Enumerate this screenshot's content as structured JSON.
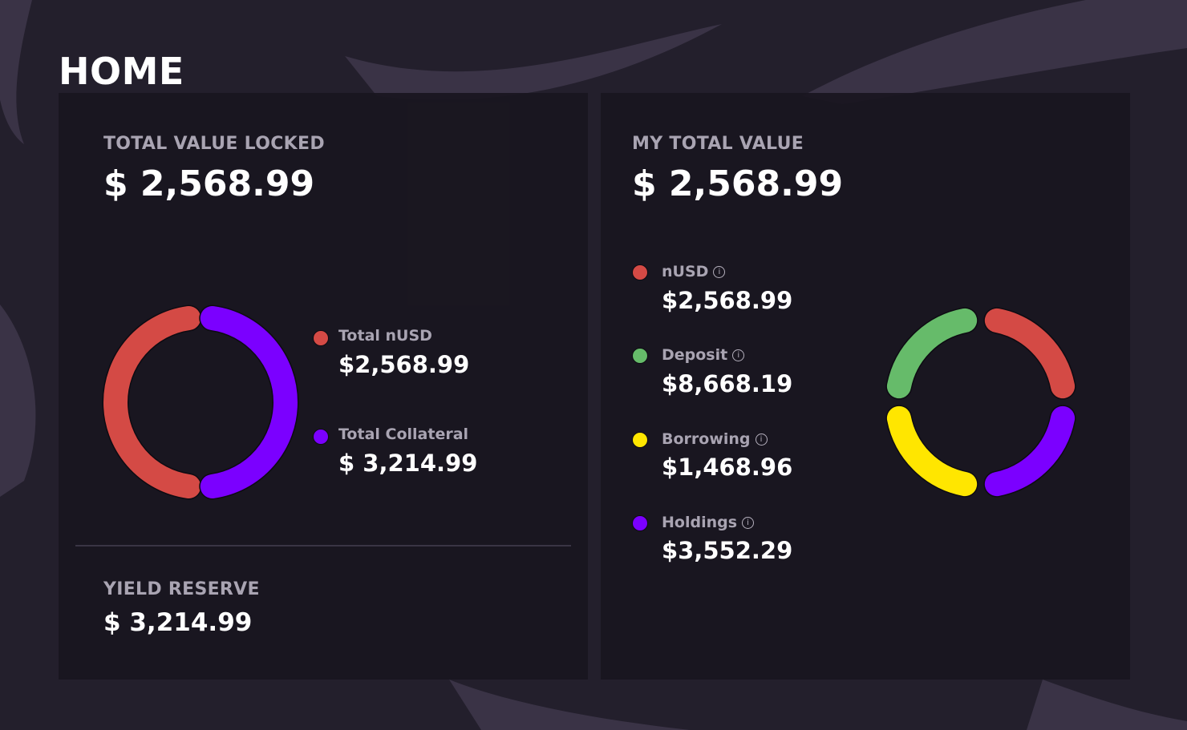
{
  "page": {
    "title": "HOME"
  },
  "tvl": {
    "label": "TOTAL VALUE LOCKED",
    "value": "$ 2,568.99",
    "legend": [
      {
        "label": "Total nUSD",
        "value": "$2,568.99",
        "color": "#d44a45"
      },
      {
        "label": "Total Collateral",
        "value": "$ 3,214.99",
        "color": "#7b00ff"
      }
    ]
  },
  "yield_reserve": {
    "label": "YIELD RESERVE",
    "value": "$  3,214.99"
  },
  "my_value": {
    "label": "MY TOTAL VALUE",
    "value": "$ 2,568.99",
    "legend": [
      {
        "label": "nUSD",
        "value": "$2,568.99",
        "color": "#d44a45",
        "info_icon": "info-icon"
      },
      {
        "label": "Deposit",
        "value": "$8,668.19",
        "color": "#66bb6a",
        "info_icon": "info-icon"
      },
      {
        "label": "Borrowing",
        "value": "$1,468.96",
        "color": "#ffe600",
        "info_icon": "info-icon"
      },
      {
        "label": "Holdings",
        "value": "$3,552.29",
        "color": "#7b00ff",
        "info_icon": "info-icon"
      }
    ]
  },
  "colors": {
    "background": "#231f2c",
    "panel": "#19161f",
    "label": "#a9a4b2",
    "red": "#d44a45",
    "purple": "#7b00ff",
    "green": "#66bb6a",
    "yellow": "#ffe600"
  }
}
